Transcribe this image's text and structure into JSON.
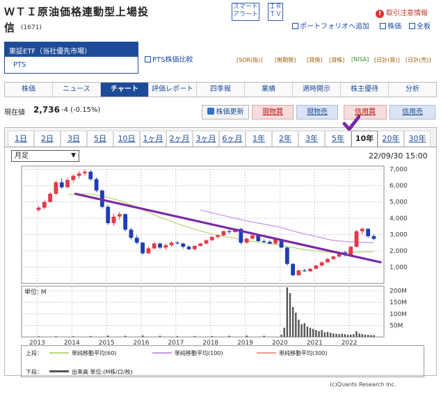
{
  "header": {
    "title_line1": "ＷＴＩ原油価格連動型上場投",
    "title_line2": "信",
    "code": "(1671)",
    "smart_alert_1": "スマート",
    "smart_alert_2": "アラート",
    "ir_1": "ＩＲ",
    "ir_2": "ＴＶ",
    "trading_alert": "取引注意情報",
    "portfolio": "ポートフォリオへ追加",
    "stock_price": "株価",
    "all_boards": "全板",
    "pts_compare": "PTS株価比較"
  },
  "market": {
    "selected": "東証ETF（当社優先市場）",
    "alt": "PTS"
  },
  "badges": [
    "[SOR(指)]",
    "[無期限] ",
    "[貸借]",
    "[貸株]",
    "[NISA]",
    "[日計(買)]",
    "[日計(売)]"
  ],
  "tabs": [
    {
      "label": "株価",
      "active": false
    },
    {
      "label": "ニュース",
      "active": false
    },
    {
      "label": "チャート",
      "active": true
    },
    {
      "label": "評価レポート",
      "active": false
    },
    {
      "label": "四季報",
      "active": false
    },
    {
      "label": "業績",
      "active": false
    },
    {
      "label": "適時開示",
      "active": false
    },
    {
      "label": "株主優待",
      "active": false
    },
    {
      "label": "分析",
      "active": false
    }
  ],
  "quote": {
    "label": "現在値",
    "price": "2,736",
    "change": "-4 (-0.15%)"
  },
  "actions": {
    "update": "株価更新",
    "cash_buy": "現物買",
    "cash_sell": "現物売",
    "margin_buy": "信用買",
    "margin_sell": "信用売"
  },
  "periods": [
    {
      "label": "1日",
      "active": false
    },
    {
      "label": "2日",
      "active": false
    },
    {
      "label": "3日",
      "active": false
    },
    {
      "label": "5日",
      "active": false
    },
    {
      "label": "10日",
      "active": false
    },
    {
      "label": "1ヶ月",
      "active": false
    },
    {
      "label": "2ヶ月",
      "active": false
    },
    {
      "label": "3ヶ月",
      "active": false
    },
    {
      "label": "6ヶ月",
      "active": false
    },
    {
      "label": "1年",
      "active": false
    },
    {
      "label": "2年",
      "active": false
    },
    {
      "label": "3年",
      "active": false
    },
    {
      "label": "5年",
      "active": false
    },
    {
      "label": "10年",
      "active": true
    },
    {
      "label": "20年",
      "active": false
    },
    {
      "label": "30年",
      "active": false
    }
  ],
  "chart_controls": {
    "interval": "月足",
    "datetime": "22/09/30 15:00"
  },
  "legend": {
    "upper_label": "上段：",
    "ma60": "単純移動平均(60)",
    "ma100": "単純移動平均(100)",
    "ma300": "単純移動平均(300)",
    "lower_label": "下段：",
    "volume": "出来高 単位:(M株/口/枚)"
  },
  "copyright": "(c)Quants Research Inc.",
  "colors": {
    "up": "#e43a4a",
    "down": "#1f3fb0",
    "ma60": "#b7d77a",
    "ma100": "#c59ae8",
    "ma300": "#e89a8a",
    "trend": "#7a2aa8",
    "accent": "#1d4b99"
  },
  "chart_data": [
    {
      "type": "candlestick",
      "title": "",
      "x_ticks": [
        "2013",
        "2014",
        "2015",
        "2016",
        "2017",
        "2018",
        "2019",
        "2020",
        "2021",
        "2022"
      ],
      "y_ticks": [
        "1,000",
        "2,000",
        "3,000",
        "4,000",
        "5,000",
        "6,000",
        "7,000"
      ],
      "ylim": [
        0,
        7200
      ],
      "candles": [
        {
          "t": "2013-01",
          "o": 4500,
          "h": 4750,
          "l": 4400,
          "c": 4650
        },
        {
          "t": "2013-03",
          "o": 4650,
          "h": 5100,
          "l": 4550,
          "c": 5000
        },
        {
          "t": "2013-05",
          "o": 5000,
          "h": 5600,
          "l": 4950,
          "c": 5500
        },
        {
          "t": "2013-07",
          "o": 5500,
          "h": 6300,
          "l": 5400,
          "c": 6200
        },
        {
          "t": "2013-09",
          "o": 6200,
          "h": 6450,
          "l": 5800,
          "c": 5900
        },
        {
          "t": "2013-11",
          "o": 5900,
          "h": 6500,
          "l": 5850,
          "c": 6350
        },
        {
          "t": "2014-01",
          "o": 6350,
          "h": 6700,
          "l": 6200,
          "c": 6600
        },
        {
          "t": "2014-03",
          "o": 6600,
          "h": 6900,
          "l": 6450,
          "c": 6750
        },
        {
          "t": "2014-05",
          "o": 6750,
          "h": 7000,
          "l": 6600,
          "c": 6850
        },
        {
          "t": "2014-07",
          "o": 6850,
          "h": 6950,
          "l": 6300,
          "c": 6400
        },
        {
          "t": "2014-09",
          "o": 6400,
          "h": 6500,
          "l": 5600,
          "c": 5700
        },
        {
          "t": "2014-11",
          "o": 5700,
          "h": 5750,
          "l": 4600,
          "c": 4700
        },
        {
          "t": "2015-01",
          "o": 4700,
          "h": 4800,
          "l": 3600,
          "c": 3700
        },
        {
          "t": "2015-03",
          "o": 3700,
          "h": 4300,
          "l": 3550,
          "c": 4100
        },
        {
          "t": "2015-05",
          "o": 4100,
          "h": 4400,
          "l": 3900,
          "c": 4250
        },
        {
          "t": "2015-07",
          "o": 4250,
          "h": 4300,
          "l": 3200,
          "c": 3300
        },
        {
          "t": "2015-09",
          "o": 3300,
          "h": 3400,
          "l": 2700,
          "c": 2800
        },
        {
          "t": "2015-11",
          "o": 2800,
          "h": 2950,
          "l": 2400,
          "c": 2500
        },
        {
          "t": "2016-01",
          "o": 2500,
          "h": 2550,
          "l": 1750,
          "c": 1850
        },
        {
          "t": "2016-03",
          "o": 1850,
          "h": 2250,
          "l": 1800,
          "c": 2150
        },
        {
          "t": "2016-05",
          "o": 2150,
          "h": 2550,
          "l": 2100,
          "c": 2450
        },
        {
          "t": "2016-07",
          "o": 2450,
          "h": 2500,
          "l": 2100,
          "c": 2200
        },
        {
          "t": "2016-09",
          "o": 2200,
          "h": 2450,
          "l": 2050,
          "c": 2350
        },
        {
          "t": "2016-11",
          "o": 2350,
          "h": 2600,
          "l": 2250,
          "c": 2500
        },
        {
          "t": "2017-01",
          "o": 2500,
          "h": 2600,
          "l": 2400,
          "c": 2450
        },
        {
          "t": "2017-03",
          "o": 2450,
          "h": 2500,
          "l": 2150,
          "c": 2250
        },
        {
          "t": "2017-05",
          "o": 2250,
          "h": 2350,
          "l": 2050,
          "c": 2100
        },
        {
          "t": "2017-07",
          "o": 2100,
          "h": 2350,
          "l": 2050,
          "c": 2300
        },
        {
          "t": "2017-09",
          "o": 2300,
          "h": 2500,
          "l": 2250,
          "c": 2450
        },
        {
          "t": "2017-11",
          "o": 2450,
          "h": 2700,
          "l": 2400,
          "c": 2650
        },
        {
          "t": "2018-01",
          "o": 2650,
          "h": 2900,
          "l": 2600,
          "c": 2850
        },
        {
          "t": "2018-03",
          "o": 2850,
          "h": 3000,
          "l": 2750,
          "c": 2950
        },
        {
          "t": "2018-05",
          "o": 2950,
          "h": 3250,
          "l": 2900,
          "c": 3200
        },
        {
          "t": "2018-07",
          "o": 3200,
          "h": 3300,
          "l": 3050,
          "c": 3150
        },
        {
          "t": "2018-09",
          "o": 3150,
          "h": 3400,
          "l": 3100,
          "c": 3350
        },
        {
          "t": "2018-11",
          "o": 3350,
          "h": 3400,
          "l": 2400,
          "c": 2500
        },
        {
          "t": "2019-01",
          "o": 2500,
          "h": 2800,
          "l": 2450,
          "c": 2750
        },
        {
          "t": "2019-03",
          "o": 2750,
          "h": 3000,
          "l": 2700,
          "c": 2950
        },
        {
          "t": "2019-05",
          "o": 2950,
          "h": 3000,
          "l": 2550,
          "c": 2600
        },
        {
          "t": "2019-07",
          "o": 2600,
          "h": 2700,
          "l": 2450,
          "c": 2550
        },
        {
          "t": "2019-09",
          "o": 2550,
          "h": 2650,
          "l": 2400,
          "c": 2450
        },
        {
          "t": "2019-11",
          "o": 2450,
          "h": 2750,
          "l": 2400,
          "c": 2700
        },
        {
          "t": "2020-01",
          "o": 2700,
          "h": 2750,
          "l": 2150,
          "c": 2200
        },
        {
          "t": "2020-03",
          "o": 2200,
          "h": 2250,
          "l": 1100,
          "c": 1200
        },
        {
          "t": "2020-05",
          "o": 1200,
          "h": 1250,
          "l": 450,
          "c": 500
        },
        {
          "t": "2020-07",
          "o": 500,
          "h": 850,
          "l": 480,
          "c": 800
        },
        {
          "t": "2020-09",
          "o": 800,
          "h": 900,
          "l": 700,
          "c": 750
        },
        {
          "t": "2020-11",
          "o": 750,
          "h": 950,
          "l": 700,
          "c": 900
        },
        {
          "t": "2021-01",
          "o": 900,
          "h": 1150,
          "l": 880,
          "c": 1100
        },
        {
          "t": "2021-03",
          "o": 1100,
          "h": 1350,
          "l": 1050,
          "c": 1300
        },
        {
          "t": "2021-05",
          "o": 1300,
          "h": 1550,
          "l": 1250,
          "c": 1500
        },
        {
          "t": "2021-07",
          "o": 1500,
          "h": 1700,
          "l": 1450,
          "c": 1650
        },
        {
          "t": "2021-09",
          "o": 1650,
          "h": 1950,
          "l": 1600,
          "c": 1900
        },
        {
          "t": "2021-11",
          "o": 1900,
          "h": 2000,
          "l": 1650,
          "c": 1750
        },
        {
          "t": "2022-01",
          "o": 1750,
          "h": 2300,
          "l": 1700,
          "c": 2250
        },
        {
          "t": "2022-03",
          "o": 2250,
          "h": 3300,
          "l": 2200,
          "c": 3200
        },
        {
          "t": "2022-05",
          "o": 3200,
          "h": 3450,
          "l": 3000,
          "c": 3350
        },
        {
          "t": "2022-07",
          "o": 3350,
          "h": 3400,
          "l": 2800,
          "c": 2900
        },
        {
          "t": "2022-09",
          "o": 2900,
          "h": 3000,
          "l": 2650,
          "c": 2736
        }
      ],
      "ma60": [
        [
          2013.9,
          5450
        ],
        [
          2014.5,
          5500
        ],
        [
          2015.0,
          5300
        ],
        [
          2015.5,
          5000
        ],
        [
          2016.0,
          4550
        ],
        [
          2016.5,
          4100
        ],
        [
          2017.0,
          3700
        ],
        [
          2017.5,
          3350
        ],
        [
          2018.0,
          3050
        ],
        [
          2018.5,
          2850
        ],
        [
          2019.0,
          2650
        ],
        [
          2019.5,
          2500
        ],
        [
          2020.0,
          2350
        ],
        [
          2020.5,
          2150
        ],
        [
          2021.0,
          2000
        ],
        [
          2021.5,
          1900
        ],
        [
          2022.0,
          1900
        ],
        [
          2022.7,
          1950
        ]
      ],
      "ma100": [
        [
          2017.7,
          4500
        ],
        [
          2018.0,
          4350
        ],
        [
          2018.5,
          4100
        ],
        [
          2019.0,
          3850
        ],
        [
          2019.5,
          3650
        ],
        [
          2020.0,
          3450
        ],
        [
          2020.5,
          3150
        ],
        [
          2021.0,
          2900
        ],
        [
          2021.5,
          2650
        ],
        [
          2022.0,
          2550
        ],
        [
          2022.7,
          2500
        ]
      ],
      "trendline": [
        [
          2014.1,
          5500
        ],
        [
          2022.9,
          1300
        ]
      ]
    },
    {
      "type": "bar",
      "title": "",
      "unit_label": "単位: M",
      "y_ticks": [
        "50M",
        "100M",
        "150M",
        "200M"
      ],
      "ylim": [
        0,
        220
      ],
      "volumes": [
        {
          "t": "2013-01",
          "v": 3
        },
        {
          "t": "2013-07",
          "v": 3
        },
        {
          "t": "2014-01",
          "v": 3
        },
        {
          "t": "2014-07",
          "v": 4
        },
        {
          "t": "2015-01",
          "v": 6
        },
        {
          "t": "2015-07",
          "v": 5
        },
        {
          "t": "2016-01",
          "v": 7
        },
        {
          "t": "2016-07",
          "v": 5
        },
        {
          "t": "2017-01",
          "v": 4
        },
        {
          "t": "2017-07",
          "v": 4
        },
        {
          "t": "2018-01",
          "v": 4
        },
        {
          "t": "2018-07",
          "v": 5
        },
        {
          "t": "2019-01",
          "v": 6
        },
        {
          "t": "2019-07",
          "v": 5
        },
        {
          "t": "2020-01",
          "v": 10
        },
        {
          "t": "2020-02",
          "v": 40
        },
        {
          "t": "2020-03",
          "v": 215
        },
        {
          "t": "2020-04",
          "v": 190
        },
        {
          "t": "2020-05",
          "v": 130
        },
        {
          "t": "2020-06",
          "v": 105
        },
        {
          "t": "2020-07",
          "v": 75
        },
        {
          "t": "2020-08",
          "v": 55
        },
        {
          "t": "2020-09",
          "v": 60
        },
        {
          "t": "2020-10",
          "v": 45
        },
        {
          "t": "2020-11",
          "v": 40
        },
        {
          "t": "2020-12",
          "v": 35
        },
        {
          "t": "2021-01",
          "v": 30
        },
        {
          "t": "2021-02",
          "v": 25
        },
        {
          "t": "2021-03",
          "v": 30
        },
        {
          "t": "2021-04",
          "v": 20
        },
        {
          "t": "2021-05",
          "v": 22
        },
        {
          "t": "2021-06",
          "v": 18
        },
        {
          "t": "2021-07",
          "v": 15
        },
        {
          "t": "2021-08",
          "v": 14
        },
        {
          "t": "2021-09",
          "v": 12
        },
        {
          "t": "2021-10",
          "v": 14
        },
        {
          "t": "2021-11",
          "v": 12
        },
        {
          "t": "2021-12",
          "v": 10
        },
        {
          "t": "2022-01",
          "v": 10
        },
        {
          "t": "2022-02",
          "v": 12
        },
        {
          "t": "2022-03",
          "v": 25
        },
        {
          "t": "2022-04",
          "v": 15
        },
        {
          "t": "2022-05",
          "v": 12
        },
        {
          "t": "2022-06",
          "v": 10
        },
        {
          "t": "2022-07",
          "v": 9
        },
        {
          "t": "2022-08",
          "v": 8
        },
        {
          "t": "2022-09",
          "v": 8
        }
      ]
    }
  ]
}
